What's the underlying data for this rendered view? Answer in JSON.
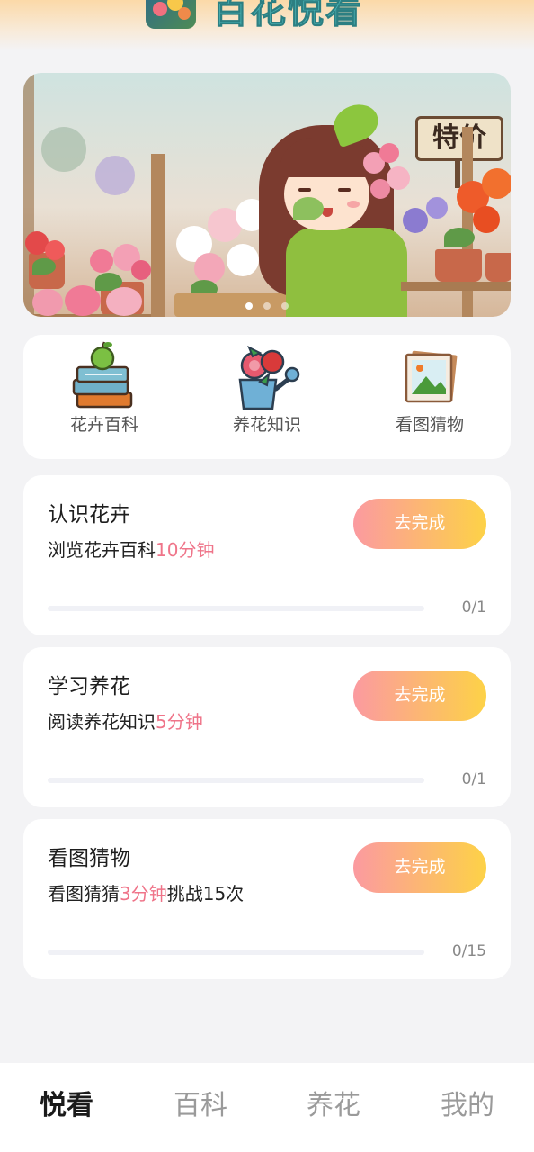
{
  "header": {
    "app_title": "百花悦看",
    "logo_icon": "flower-app-logo-icon"
  },
  "banner": {
    "sign_text": "特价",
    "slide_count": 3,
    "active_slide": 1
  },
  "categories": [
    {
      "label": "花卉百科",
      "icon": "book-stack-apple-icon"
    },
    {
      "label": "养花知识",
      "icon": "rose-watering-can-icon"
    },
    {
      "label": "看图猜物",
      "icon": "picture-frame-icon"
    }
  ],
  "tasks": [
    {
      "title": "认识花卉",
      "desc_prefix": "浏览花卉百科",
      "desc_highlight": "10分钟",
      "desc_suffix": "",
      "button": "去完成",
      "progress_text": "0/1",
      "progress": 0
    },
    {
      "title": "学习养花",
      "desc_prefix": "阅读养花知识",
      "desc_highlight": "5分钟",
      "desc_suffix": "",
      "button": "去完成",
      "progress_text": "0/1",
      "progress": 0
    },
    {
      "title": "看图猜物",
      "desc_prefix": "看图猜猜",
      "desc_highlight": "3分钟",
      "desc_suffix": "挑战15次",
      "button": "去完成",
      "progress_text": "0/15",
      "progress": 0
    }
  ],
  "bottom_nav": [
    {
      "label": "悦看",
      "active": true
    },
    {
      "label": "百科",
      "active": false
    },
    {
      "label": "养花",
      "active": false
    },
    {
      "label": "我的",
      "active": false
    }
  ],
  "colors": {
    "accent_pink": "#ef7489",
    "button_gradient_start": "#fb9aa0",
    "button_gradient_end": "#fdd247",
    "title_teal": "#4cb5b6"
  }
}
